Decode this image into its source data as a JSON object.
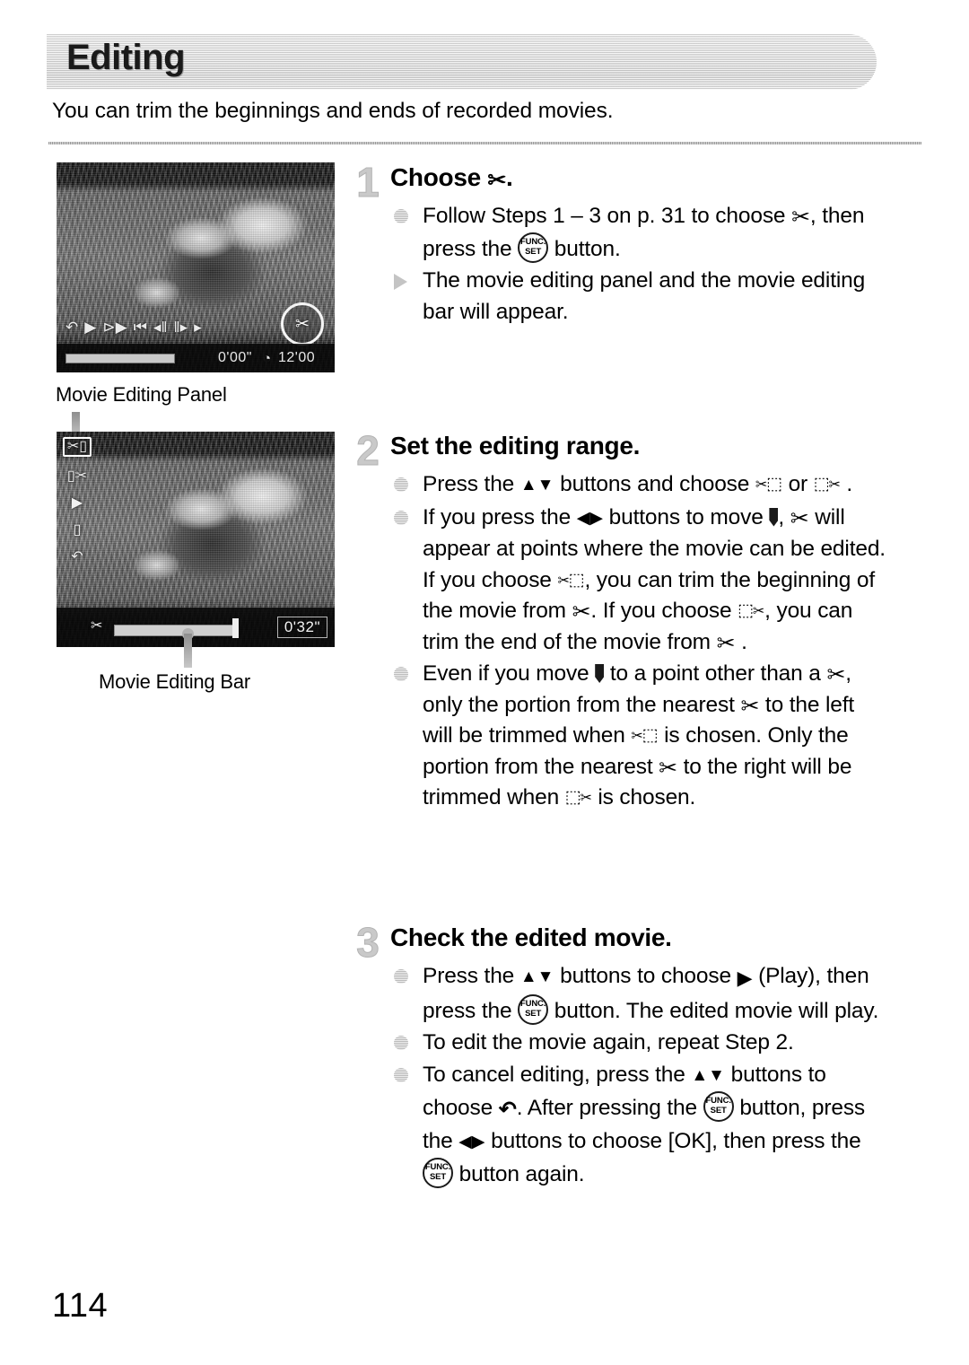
{
  "header": {
    "title": "Editing",
    "intro": "You can trim the beginnings and ends of recorded movies."
  },
  "figures": [
    {
      "name": "movie-editing-panel-screenshot",
      "caption": "Movie Editing Panel",
      "panel_icons": [
        "return-icon",
        "play-icon",
        "slow-motion-icon",
        "first-frame-icon",
        "previous-frame-icon",
        "next-frame-icon",
        "last-frame-icon"
      ],
      "selected_icon": "scissors-icon",
      "elapsed_time": "0'00\"",
      "total_time": "12'00",
      "clock_icon": "clock-icon"
    },
    {
      "name": "movie-editing-bar-screenshot",
      "caption": "Movie Editing Bar",
      "vertical_panel_icons": [
        "trim-beginning-icon",
        "trim-end-icon",
        "play-icon",
        "save-icon",
        "return-icon"
      ],
      "selected_icon": "trim-beginning-icon",
      "time": "0'32\"",
      "marker_icon": "position-marker-icon",
      "scissors_icon": "scissors-icon"
    }
  ],
  "steps": [
    {
      "number": "1",
      "heading_prefix": "Choose",
      "heading_suffix": ".",
      "bullets": [
        {
          "marker": "dot",
          "parts": [
            {
              "t": "text",
              "v": "Follow Steps 1 – 3 on p. 31 to choose "
            },
            {
              "t": "icon",
              "v": "scissors-icon"
            },
            {
              "t": "text",
              "v": ", then press the "
            },
            {
              "t": "icon",
              "v": "func-set-button-icon"
            },
            {
              "t": "text",
              "v": " button."
            }
          ]
        },
        {
          "marker": "tri",
          "parts": [
            {
              "t": "text",
              "v": "The movie editing panel and the movie editing bar will appear."
            }
          ]
        }
      ]
    },
    {
      "number": "2",
      "heading_prefix": "Set the editing range.",
      "heading_suffix": "",
      "bullets": [
        {
          "marker": "dot",
          "parts": [
            {
              "t": "text",
              "v": "Press the "
            },
            {
              "t": "icon",
              "v": "up-down-buttons-icon"
            },
            {
              "t": "text",
              "v": " buttons and choose "
            },
            {
              "t": "icon",
              "v": "trim-beginning-icon"
            },
            {
              "t": "text",
              "v": " or "
            },
            {
              "t": "icon",
              "v": "trim-end-icon"
            },
            {
              "t": "text",
              "v": " ."
            }
          ]
        },
        {
          "marker": "dot",
          "parts": [
            {
              "t": "text",
              "v": "If you press the "
            },
            {
              "t": "icon",
              "v": "left-right-buttons-icon"
            },
            {
              "t": "text",
              "v": " buttons to move "
            },
            {
              "t": "icon",
              "v": "position-marker-icon"
            },
            {
              "t": "text",
              "v": ", "
            },
            {
              "t": "icon",
              "v": "scissors-icon"
            },
            {
              "t": "text",
              "v": " will appear at points where the movie can be edited. If you choose "
            },
            {
              "t": "icon",
              "v": "trim-beginning-icon"
            },
            {
              "t": "text",
              "v": ", you can trim the beginning of the movie from "
            },
            {
              "t": "icon",
              "v": "scissors-icon"
            },
            {
              "t": "text",
              "v": ". If you choose "
            },
            {
              "t": "icon",
              "v": "trim-end-icon"
            },
            {
              "t": "text",
              "v": ", you can trim the end of the movie from "
            },
            {
              "t": "icon",
              "v": "scissors-icon"
            },
            {
              "t": "text",
              "v": " ."
            }
          ]
        },
        {
          "marker": "dot",
          "parts": [
            {
              "t": "text",
              "v": "Even if you move "
            },
            {
              "t": "icon",
              "v": "position-marker-icon"
            },
            {
              "t": "text",
              "v": " to a point other than a "
            },
            {
              "t": "icon",
              "v": "scissors-icon"
            },
            {
              "t": "text",
              "v": ", only the portion from the nearest "
            },
            {
              "t": "icon",
              "v": "scissors-icon"
            },
            {
              "t": "text",
              "v": " to the left will be trimmed when "
            },
            {
              "t": "icon",
              "v": "trim-beginning-icon"
            },
            {
              "t": "text",
              "v": " is chosen. Only the portion from the nearest "
            },
            {
              "t": "icon",
              "v": "scissors-icon"
            },
            {
              "t": "text",
              "v": " to the right will be trimmed when "
            },
            {
              "t": "icon",
              "v": "trim-end-icon"
            },
            {
              "t": "text",
              "v": " is chosen."
            }
          ]
        }
      ]
    },
    {
      "number": "3",
      "heading_prefix": "Check the edited movie.",
      "heading_suffix": "",
      "bullets": [
        {
          "marker": "dot",
          "parts": [
            {
              "t": "text",
              "v": "Press the "
            },
            {
              "t": "icon",
              "v": "up-down-buttons-icon"
            },
            {
              "t": "text",
              "v": " buttons to choose "
            },
            {
              "t": "icon",
              "v": "play-icon"
            },
            {
              "t": "text",
              "v": " (Play), then press the "
            },
            {
              "t": "icon",
              "v": "func-set-button-icon"
            },
            {
              "t": "text",
              "v": " button. The edited movie will play."
            }
          ]
        },
        {
          "marker": "dot",
          "parts": [
            {
              "t": "text",
              "v": "To edit the movie again, repeat Step 2."
            }
          ]
        },
        {
          "marker": "dot",
          "parts": [
            {
              "t": "text",
              "v": "To cancel editing, press the "
            },
            {
              "t": "icon",
              "v": "up-down-buttons-icon"
            },
            {
              "t": "text",
              "v": " buttons to choose "
            },
            {
              "t": "icon",
              "v": "return-icon"
            },
            {
              "t": "text",
              "v": ". After pressing the "
            },
            {
              "t": "icon",
              "v": "func-set-button-icon"
            },
            {
              "t": "text",
              "v": " button, press the "
            },
            {
              "t": "icon",
              "v": "left-right-buttons-icon"
            },
            {
              "t": "text",
              "v": " buttons to choose [OK], then press the "
            },
            {
              "t": "icon",
              "v": "func-set-button-icon"
            },
            {
              "t": "text",
              "v": " button again."
            }
          ]
        }
      ]
    }
  ],
  "footer": {
    "page_number": "114"
  },
  "icon_glyphs": {
    "scissors-icon": "✂",
    "play-icon": "▶",
    "return-icon": "↶",
    "up-down-buttons-icon": "▲▼",
    "left-right-buttons-icon": "◀▶",
    "func-set-button-icon": "FUNC./SET",
    "clock-icon": "◔",
    "slow-motion-icon": "⏩",
    "first-frame-icon": "⏮",
    "previous-frame-icon": "⏴",
    "next-frame-icon": "⏵",
    "last-frame-icon": "⏭",
    "save-icon": "⬚",
    "trim-beginning-icon": "✂⬚",
    "trim-end-icon": "⬚✂",
    "position-marker-icon": "▮"
  }
}
